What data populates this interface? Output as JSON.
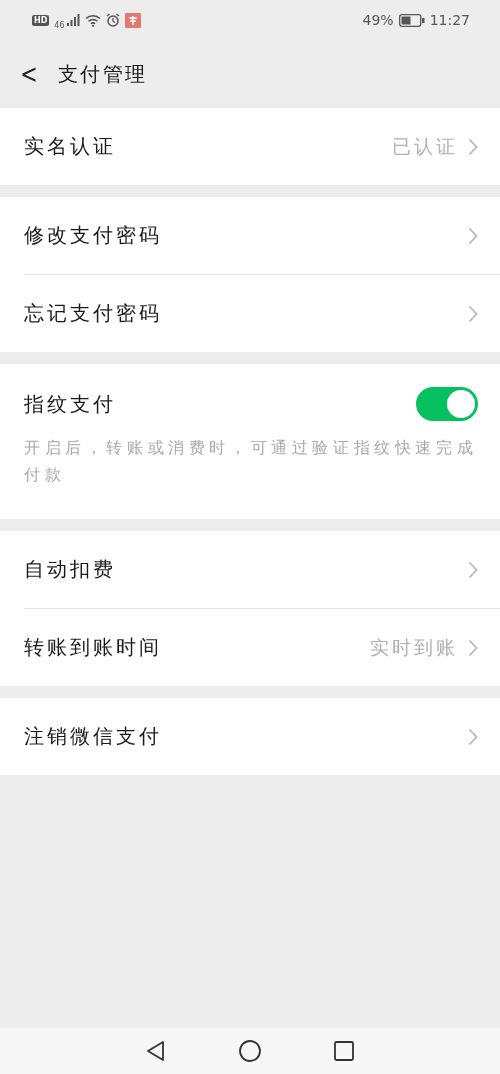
{
  "status_bar": {
    "hd": "HD",
    "network": "46",
    "battery_percent": "49%",
    "time": "11:27"
  },
  "header": {
    "back": "<",
    "title": "支付管理"
  },
  "groups": [
    {
      "items": [
        {
          "kind": "link",
          "label": "实名认证",
          "value": "已认证"
        }
      ]
    },
    {
      "items": [
        {
          "kind": "link",
          "label": "修改支付密码"
        },
        {
          "kind": "link",
          "label": "忘记支付密码"
        }
      ]
    },
    {
      "items": [
        {
          "kind": "toggle",
          "label": "指纹支付",
          "on": true,
          "description": "开启后，转账或消费时，可通过验证指纹快速完成付款"
        }
      ]
    },
    {
      "items": [
        {
          "kind": "link",
          "label": "自动扣费"
        },
        {
          "kind": "link",
          "label": "转账到账时间",
          "value": "实时到账"
        }
      ]
    },
    {
      "items": [
        {
          "kind": "link",
          "label": "注销微信支付"
        }
      ]
    }
  ]
}
